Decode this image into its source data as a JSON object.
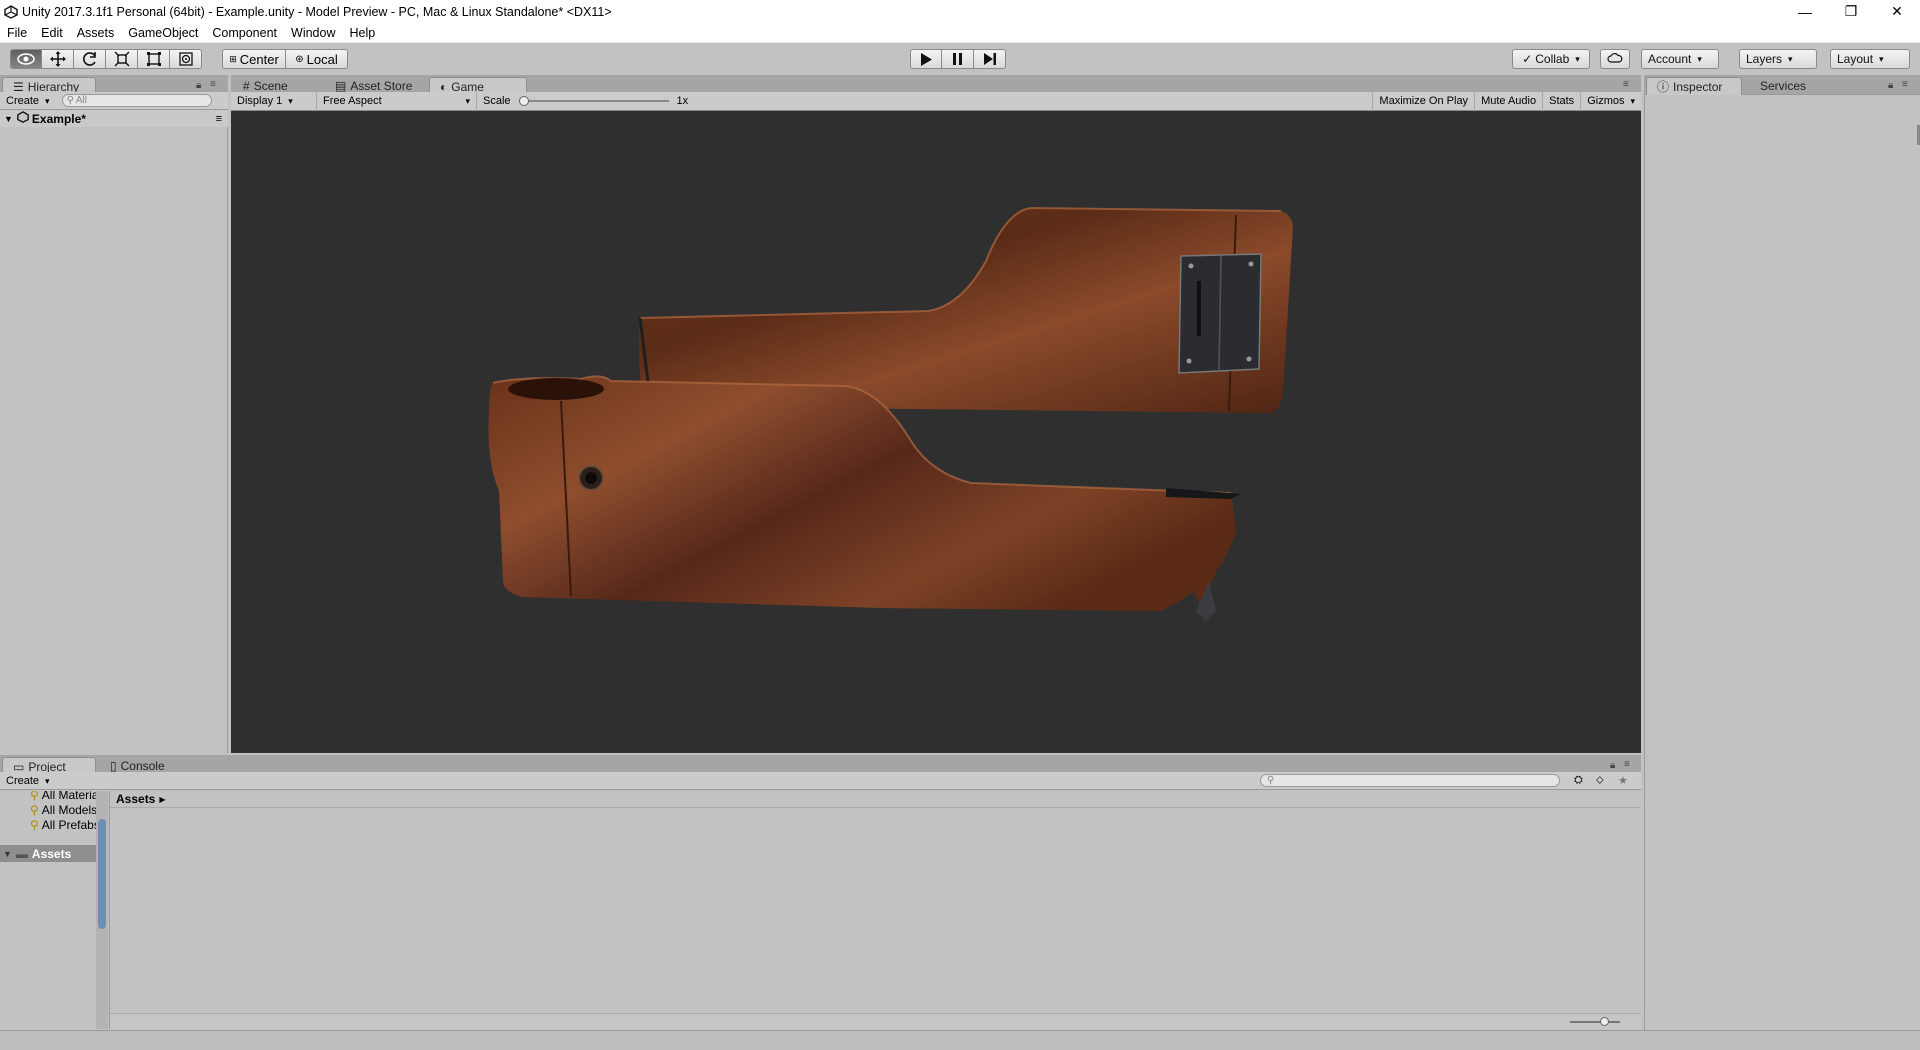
{
  "window": {
    "title": "Unity 2017.3.1f1 Personal (64bit) - Example.unity - Model Preview - PC, Mac & Linux Standalone* <DX11>",
    "minimize": "—",
    "maximize": "❐",
    "close": "✕"
  },
  "menu": [
    "File",
    "Edit",
    "Assets",
    "GameObject",
    "Component",
    "Window",
    "Help"
  ],
  "toolbar": {
    "tools": [
      "view-tool",
      "move-tool",
      "rotate-tool",
      "scale-tool",
      "rect-tool",
      "transform-tool"
    ],
    "pivot_mode": "Center",
    "pivot_rotation": "Local",
    "play": "▶",
    "pause": "❚❚",
    "step": "▶❙",
    "collab": "Collab",
    "account": "Account",
    "layers": "Layers",
    "layout": "Layout"
  },
  "hierarchy": {
    "tab": "Hierarchy",
    "create": "Create",
    "search_placeholder": "All",
    "scene": "Example*"
  },
  "center_tabs": {
    "scene": "Scene",
    "asset_store": "Asset Store",
    "game": "Game"
  },
  "game_toolbar": {
    "display": "Display 1",
    "aspect": "Free Aspect",
    "scale_label": "Scale",
    "scale_value": "1x",
    "scale_level": 0.0,
    "maximize_on_play": "Maximize On Play",
    "mute_audio": "Mute Audio",
    "stats": "Stats",
    "gizmos": "Gizmos"
  },
  "inspector": {
    "tab": "Inspector",
    "services": "Services"
  },
  "project": {
    "tab": "Project",
    "console": "Console",
    "create": "Create",
    "favorites": [
      "All Materials",
      "All Models",
      "All Prefabs"
    ],
    "assets_folder": "Assets",
    "breadcrumb": "Assets"
  },
  "colors": {
    "editor_bg": "#c2c2c2",
    "game_bg": "#2f2f2f",
    "wood_dark": "#4a2412",
    "wood_light": "#8b4a2a"
  }
}
